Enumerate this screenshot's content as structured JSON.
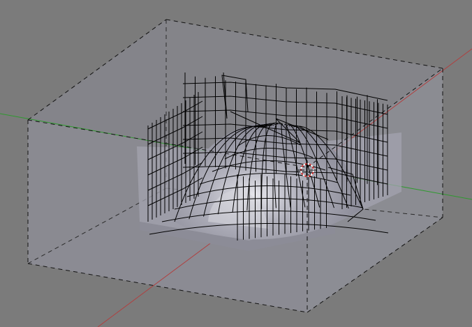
{
  "viewport": {
    "type": "3d-viewport",
    "background_color": "#7b7b7b",
    "x_axis_color": "#b04040",
    "y_axis_color": "#2f9a2f",
    "wire_color": "#000000",
    "domain_box_style": "dashed",
    "domain_face_color": "#8a8a95",
    "mesh_color": "#a9a9b4",
    "cursor_icon": "3d-cursor-icon"
  }
}
